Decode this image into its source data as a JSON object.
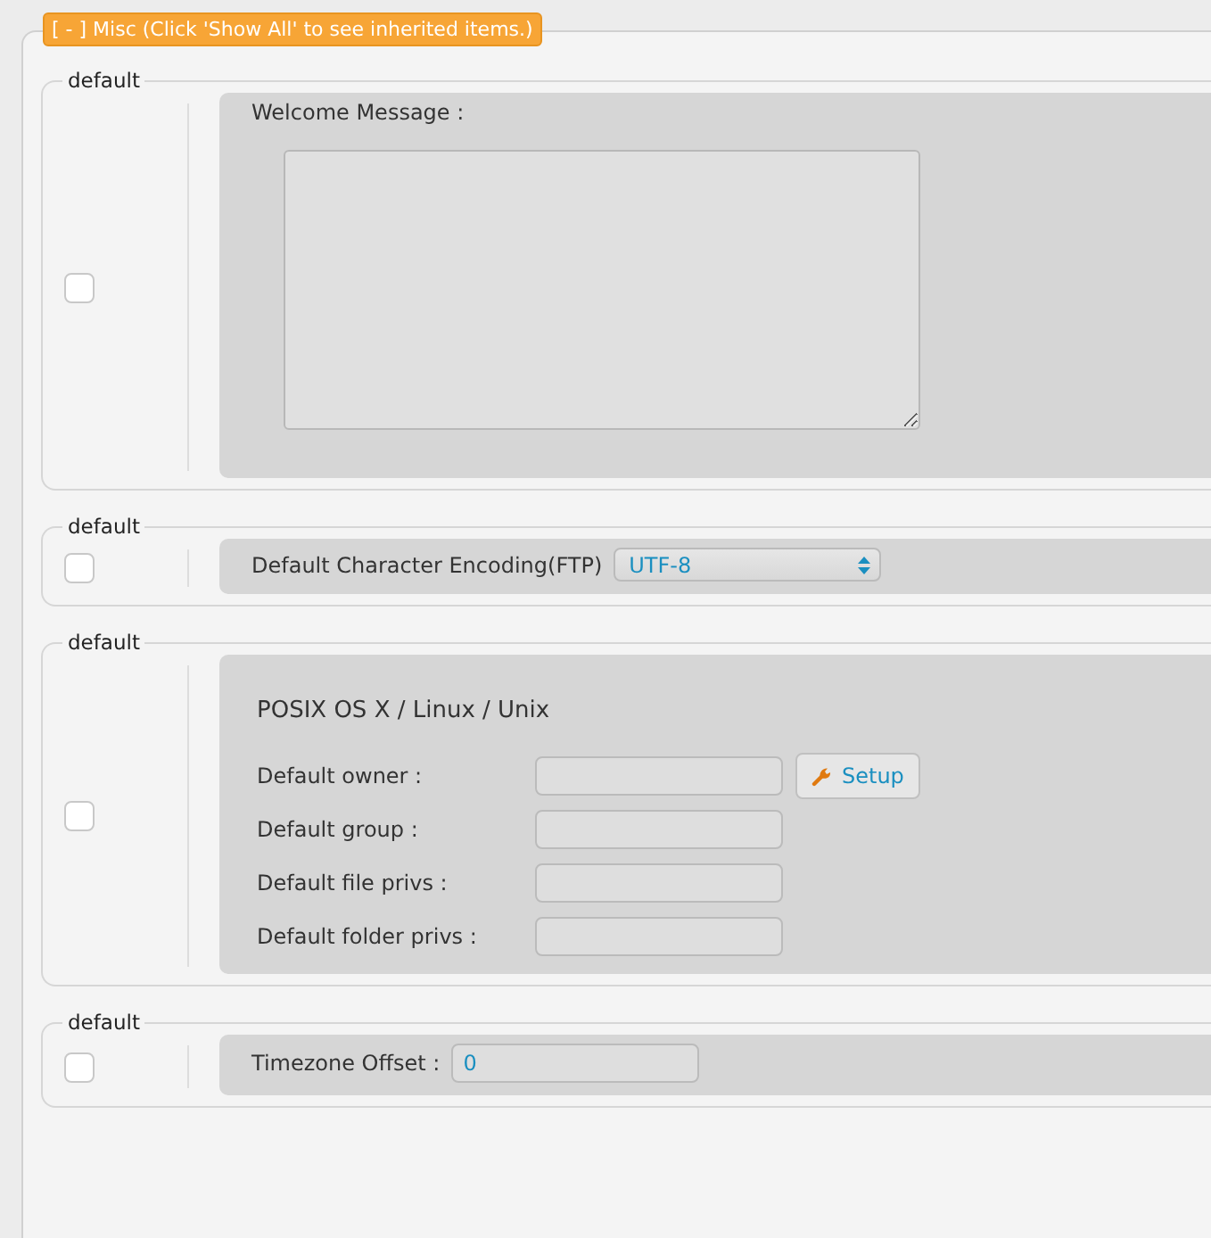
{
  "header": {
    "label": "[ - ] Misc (Click 'Show All' to see inherited items.)"
  },
  "sections": [
    {
      "legend": "default",
      "checked": false,
      "kind": "textarea",
      "label": "Welcome Message :"
    },
    {
      "legend": "default",
      "checked": false,
      "kind": "select",
      "label": "Default Character Encoding(FTP)",
      "value": "UTF-8"
    },
    {
      "legend": "default",
      "checked": false,
      "kind": "form",
      "title": "POSIX OS X / Linux / Unix",
      "fields": [
        {
          "label": "Default owner :",
          "button": "Setup"
        },
        {
          "label": "Default group :"
        },
        {
          "label": "Default file privs :"
        },
        {
          "label": "Default folder privs :"
        }
      ]
    },
    {
      "legend": "default",
      "checked": false,
      "kind": "input",
      "label": "Timezone Offset :",
      "value": "0"
    }
  ]
}
